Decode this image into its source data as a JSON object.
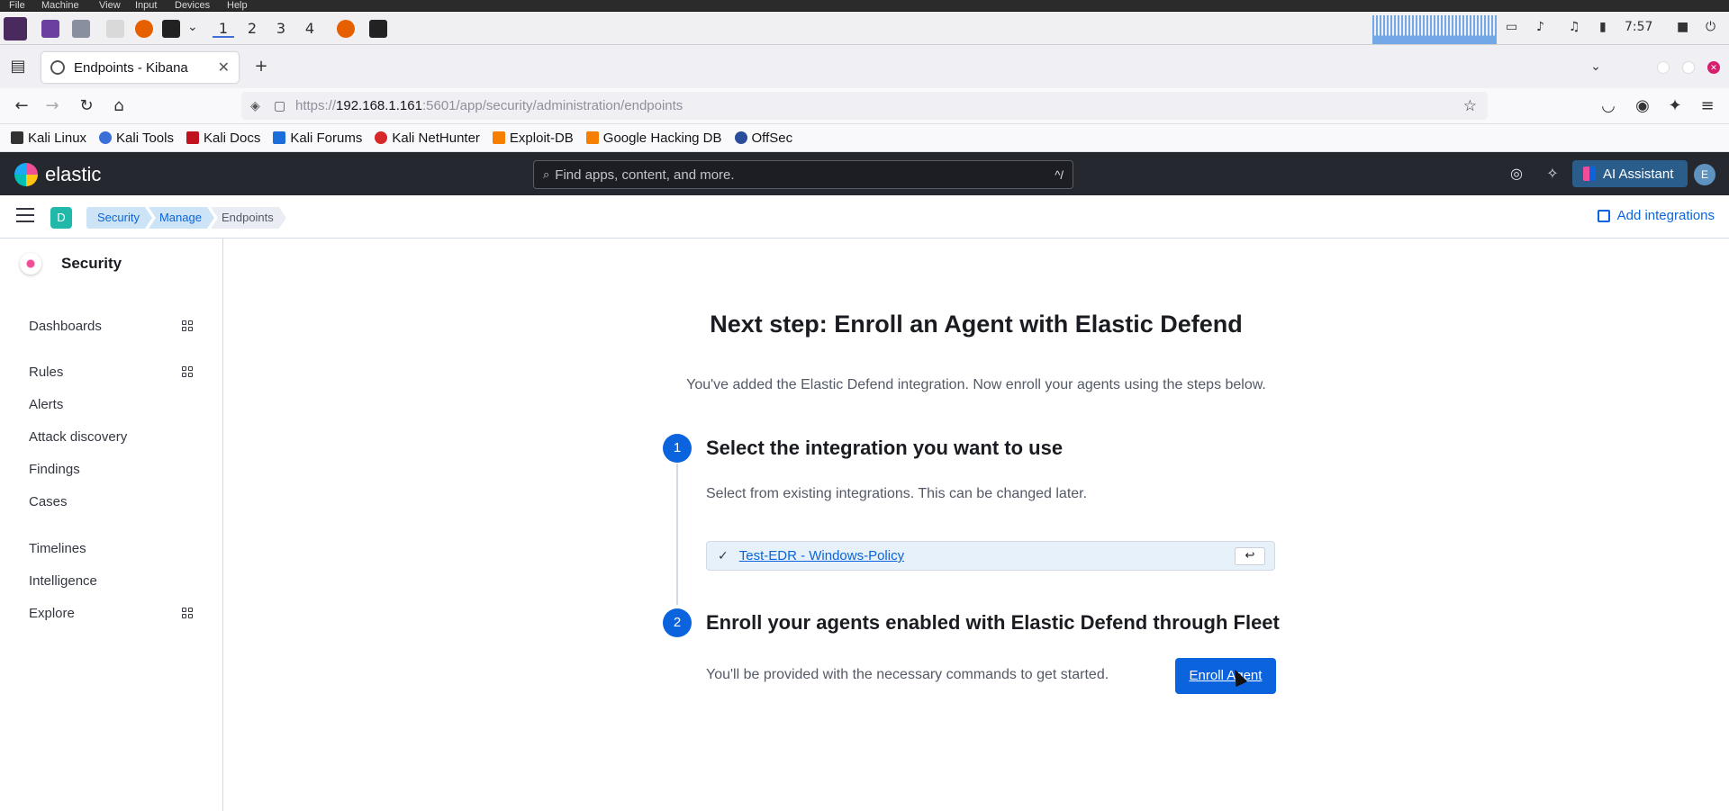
{
  "host_menu": [
    "File",
    "Machine",
    "View",
    "Input",
    "Devices",
    "Help"
  ],
  "taskbar": {
    "workspaces": [
      "1",
      "2",
      "3",
      "4"
    ],
    "clock": "7:57"
  },
  "browser": {
    "tab_title": "Endpoints - Kibana",
    "url_scheme": "https://",
    "url_host": "192.168.1.161",
    "url_rest": ":5601/app/security/administration/endpoints",
    "bookmarks": [
      "Kali Linux",
      "Kali Tools",
      "Kali Docs",
      "Kali Forums",
      "Kali NetHunter",
      "Exploit-DB",
      "Google Hacking DB",
      "OffSec"
    ]
  },
  "kibana": {
    "brand": "elastic",
    "search_placeholder": "Find apps, content, and more.",
    "search_shortcut": "^/",
    "ai_assistant": "AI Assistant",
    "user_initial": "E",
    "space_initial": "D",
    "breadcrumbs": [
      "Security",
      "Manage",
      "Endpoints"
    ],
    "add_integrations": "Add integrations"
  },
  "sidebar": {
    "title": "Security",
    "items": [
      "Dashboards",
      "Rules",
      "Alerts",
      "Attack discovery",
      "Findings",
      "Cases",
      "Timelines",
      "Intelligence",
      "Explore"
    ]
  },
  "main": {
    "heading": "Next step: Enroll an Agent with Elastic Defend",
    "subheading": "You've added the Elastic Defend integration. Now enroll your agents using the steps below.",
    "step1_num": "1",
    "step1_title": "Select the integration you want to use",
    "step1_text": "Select from existing integrations. This can be changed later.",
    "selected_policy": "Test-EDR - Windows-Policy",
    "step2_num": "2",
    "step2_title": "Enroll your agents enabled with Elastic Defend through Fleet",
    "step2_text": "You'll be provided with the necessary commands to get started.",
    "enroll_button": "Enroll Agent"
  },
  "colors": {
    "primary": "#0b64dd",
    "header_bg": "#25282f"
  }
}
